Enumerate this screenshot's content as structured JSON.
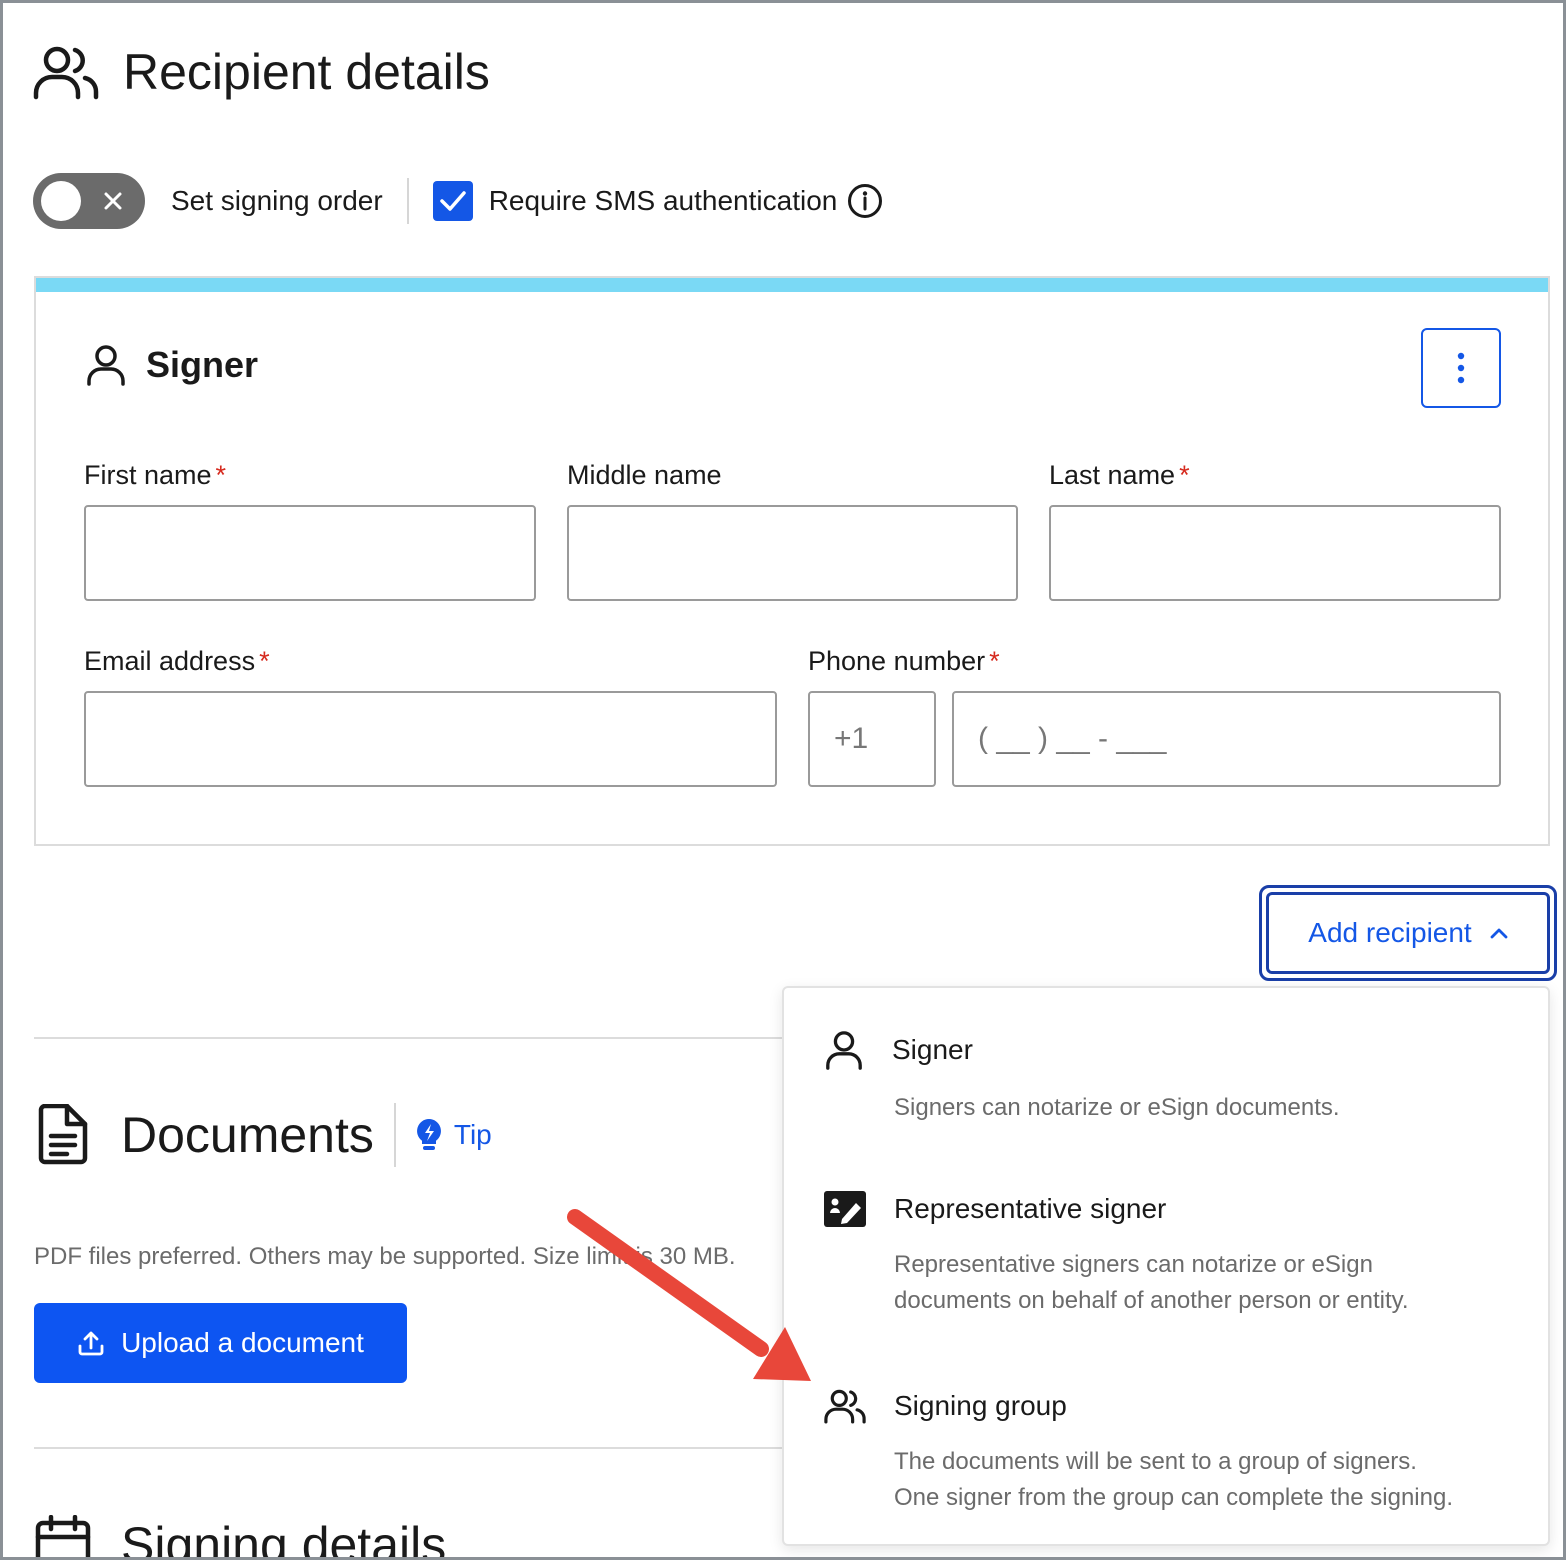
{
  "recipient_section": {
    "title": "Recipient details"
  },
  "toolbar": {
    "signing_order_label": "Set signing order",
    "sms_auth_label": "Require SMS authentication",
    "sms_auth_checked": true,
    "signing_order_enabled": false
  },
  "signer_card": {
    "title": "Signer",
    "accent_color": "#7ad9f5",
    "fields": {
      "first_name": {
        "label": "First name",
        "value": ""
      },
      "middle_name": {
        "label": "Middle name",
        "value": ""
      },
      "last_name": {
        "label": "Last name",
        "value": ""
      },
      "email": {
        "label": "Email address",
        "value": ""
      },
      "phone": {
        "label": "Phone number",
        "country_code": "+1",
        "placeholder": "( __ ) __ - ___"
      }
    },
    "required_mark": "*"
  },
  "add_recipient": {
    "label": "Add recipient",
    "menu": [
      {
        "icon": "person-icon",
        "name": "Signer",
        "desc_lines": [
          "Signers can notarize or eSign documents."
        ]
      },
      {
        "icon": "id-card-pen-icon",
        "name": "Representative signer",
        "desc_lines": [
          "Representative signers can notarize or eSign",
          "documents on behalf of another person or entity."
        ]
      },
      {
        "icon": "people-group-icon",
        "name": "Signing group",
        "desc_lines": [
          "The documents will be sent to a group of signers.",
          "One signer from the group can complete the signing."
        ]
      }
    ]
  },
  "documents_section": {
    "title": "Documents",
    "tip_label": "Tip",
    "hint": "PDF files preferred. Others may be supported. Size limit is 30 MB.",
    "upload_label": "Upload a document"
  },
  "signing_section": {
    "title": "Signing details"
  },
  "colors": {
    "primary": "#1457e6",
    "upload_bg": "#0d55f2",
    "required": "#d62a1e",
    "arrow": "#e8473a"
  }
}
